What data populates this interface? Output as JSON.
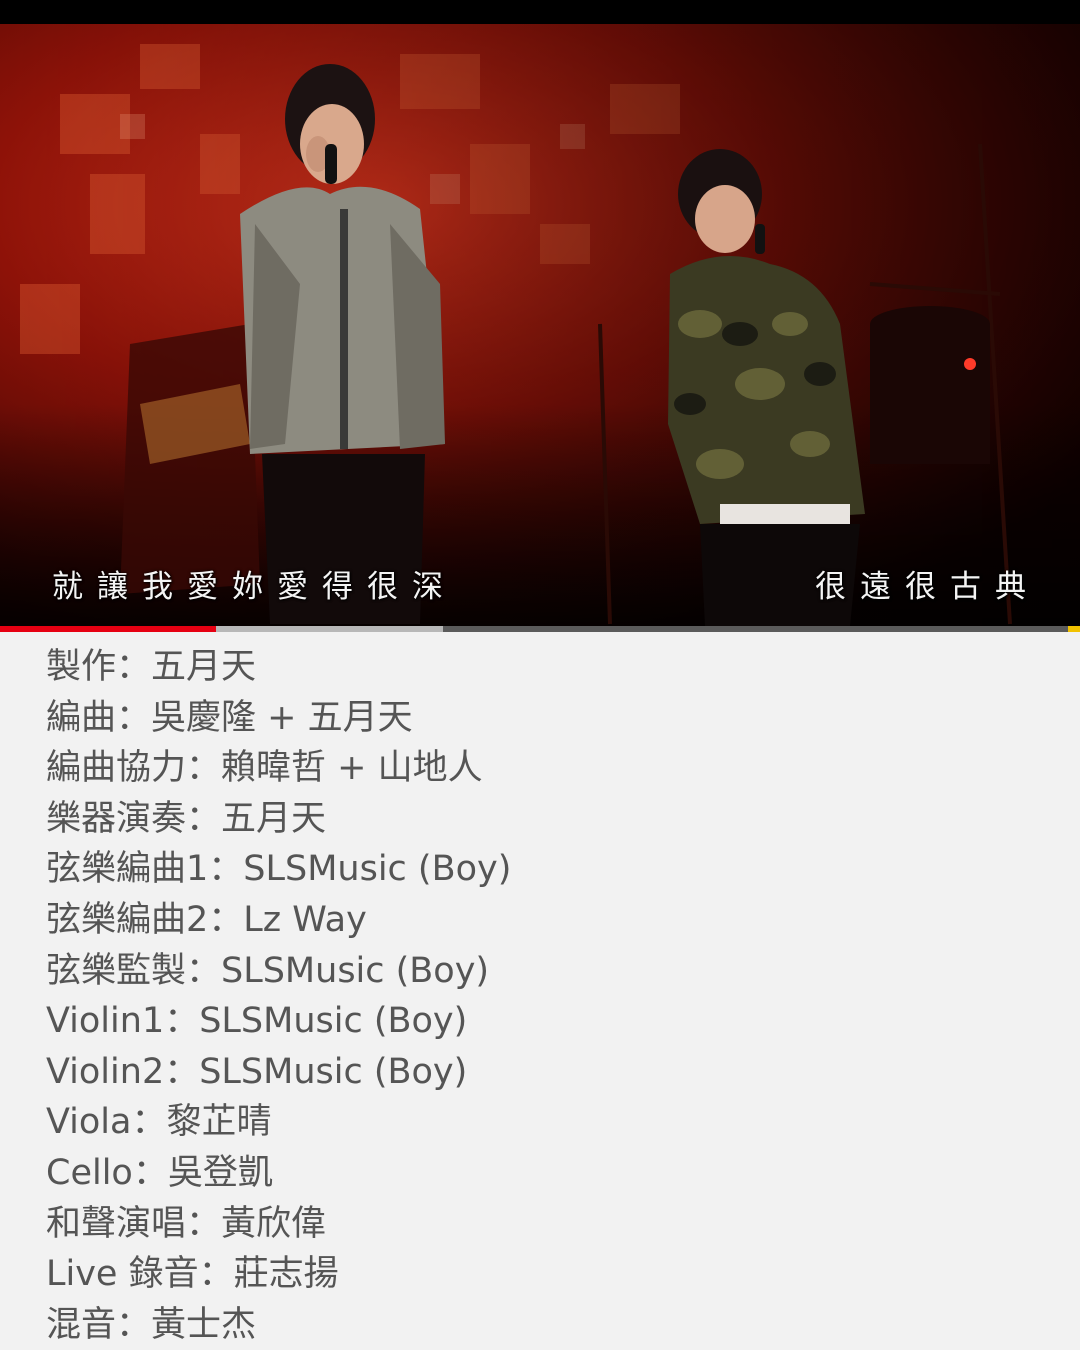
{
  "video": {
    "subtitle_left": "就讓我愛妳愛得很深",
    "subtitle_right": "很遠很古典",
    "progress_played_fraction": 0.2,
    "progress_buffered_fraction": 0.41,
    "accent_color": "#e60012"
  },
  "credits": [
    "製作：五月天",
    "編曲：吳慶隆 + 五月天",
    "編曲協力：賴暐哲 + 山地人",
    "樂器演奏：五月天",
    "弦樂編曲1：SLSMusic (Boy)",
    "弦樂編曲2：Lz Way",
    "弦樂監製：SLSMusic (Boy)",
    "Violin1：SLSMusic (Boy)",
    "Violin2：SLSMusic (Boy)",
    "Viola：黎芷晴",
    "Cello：吳登凱",
    "和聲演唱：黃欣偉",
    "Live 錄音：莊志揚",
    "混音：黃士杰"
  ]
}
